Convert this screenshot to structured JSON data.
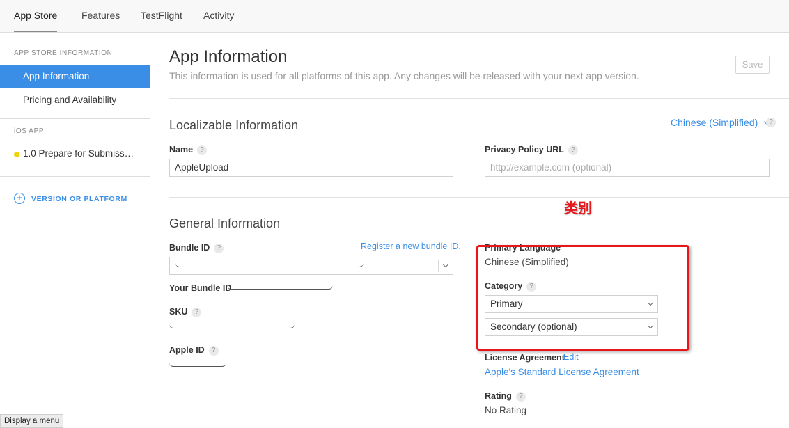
{
  "nav": {
    "tabs": [
      {
        "label": "App Store"
      },
      {
        "label": "Features"
      },
      {
        "label": "TestFlight"
      },
      {
        "label": "Activity"
      }
    ]
  },
  "sidebar": {
    "section1_heading": "APP STORE INFORMATION",
    "items": [
      {
        "label": "App Information"
      },
      {
        "label": "Pricing and Availability"
      }
    ],
    "section2_heading": "iOS APP",
    "version_item": "1.0 Prepare for Submiss…",
    "add_label": "VERSION OR PLATFORM"
  },
  "header": {
    "title": "App Information",
    "subtitle": "This information is used for all platforms of this app. Any changes will be released with your next app version.",
    "save_label": "Save"
  },
  "localizable": {
    "title": "Localizable Information",
    "language": "Chinese (Simplified)",
    "name_label": "Name",
    "name_value": "AppleUpload",
    "privacy_label": "Privacy Policy URL",
    "privacy_placeholder": "http://example.com (optional)"
  },
  "general": {
    "title": "General Information",
    "bundle_label": "Bundle ID",
    "register_link": "Register a new bundle ID.",
    "your_bundle_label": "Your Bundle ID",
    "sku_label": "SKU",
    "apple_id_label": "Apple ID",
    "primary_language_label": "Primary Language",
    "primary_language_value": "Chinese (Simplified)",
    "category_label": "Category",
    "category_primary": "Primary",
    "category_secondary": "Secondary (optional)",
    "license_label": "License Agreement",
    "license_edit": "Edit",
    "license_link": "Apple's Standard License Agreement",
    "rating_label": "Rating",
    "rating_value": "No Rating"
  },
  "annotation": {
    "text": "类别",
    "color": "#e8151a"
  },
  "tooltip": "Display a menu",
  "question_mark": "?",
  "colors": {
    "accent": "#3a8ee6",
    "status_dot": "#f2d20a"
  },
  "icons": {
    "add": "plus-circle-icon",
    "dropdown": "chevron-down-icon",
    "help": "question-icon"
  }
}
